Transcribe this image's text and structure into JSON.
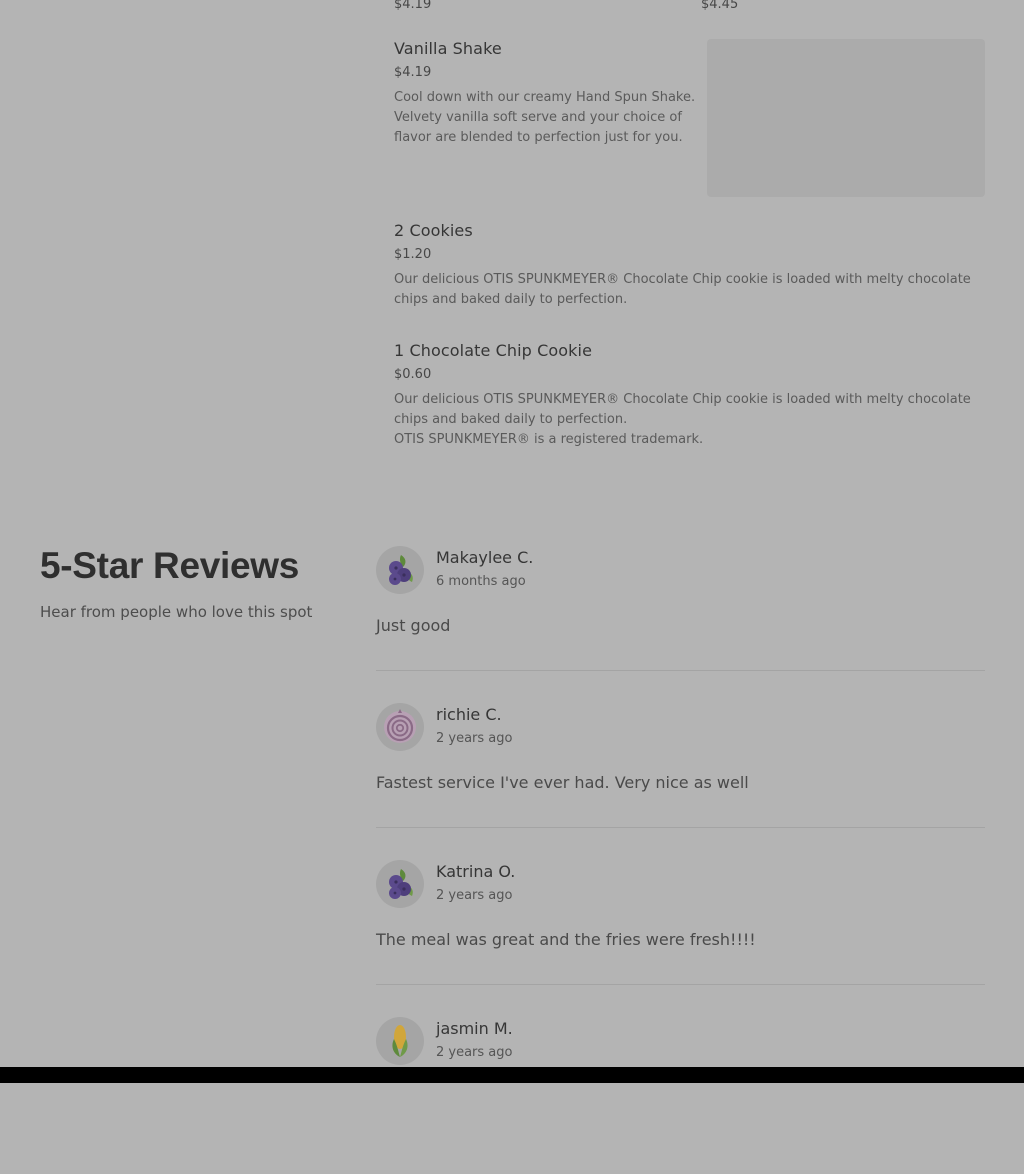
{
  "menu": {
    "top_prices": [
      "$4.19",
      "$4.45"
    ],
    "items": [
      {
        "name": "Vanilla Shake",
        "price": "$4.19",
        "description": [
          "Cool down with our creamy Hand Spun Shake.",
          "Velvety vanilla soft serve and your choice of",
          "flavor are blended to perfection just for you."
        ]
      },
      {
        "name": "2 Cookies",
        "price": "$1.20",
        "description": [
          "Our delicious OTIS SPUNKMEYER® Chocolate Chip cookie is loaded with melty chocolate",
          "chips and baked daily to perfection."
        ]
      },
      {
        "name": "1 Chocolate Chip Cookie",
        "price": "$0.60",
        "description": [
          "Our delicious OTIS SPUNKMEYER® Chocolate Chip cookie is loaded with melty chocolate",
          "chips and baked daily to perfection.",
          "OTIS SPUNKMEYER® is a registered trademark."
        ]
      }
    ]
  },
  "reviews": {
    "title": "5-Star Reviews",
    "subtitle": "Hear from people who love this spot",
    "items": [
      {
        "name": "Makaylee C.",
        "when": "6 months ago",
        "text": "Just good",
        "avatar_icon": "blueberry-icon"
      },
      {
        "name": "richie C.",
        "when": "2 years ago",
        "text": "Fastest service I've ever had. Very nice as well",
        "avatar_icon": "onion-icon"
      },
      {
        "name": "Katrina O.",
        "when": "2 years ago",
        "text": "The meal was great and the fries were fresh!!!!",
        "avatar_icon": "blueberry-icon"
      },
      {
        "name": "jasmin M.",
        "when": "2 years ago",
        "text": "",
        "avatar_icon": "corn-icon"
      }
    ]
  },
  "colors": {
    "overlay_background": "#b4b4b4",
    "avatar_background": "#a5a5a5",
    "berry": "#5b4a8c",
    "leaf": "#5e8a3c",
    "onion": "#8a6a86",
    "corn": "#d1a63b"
  }
}
